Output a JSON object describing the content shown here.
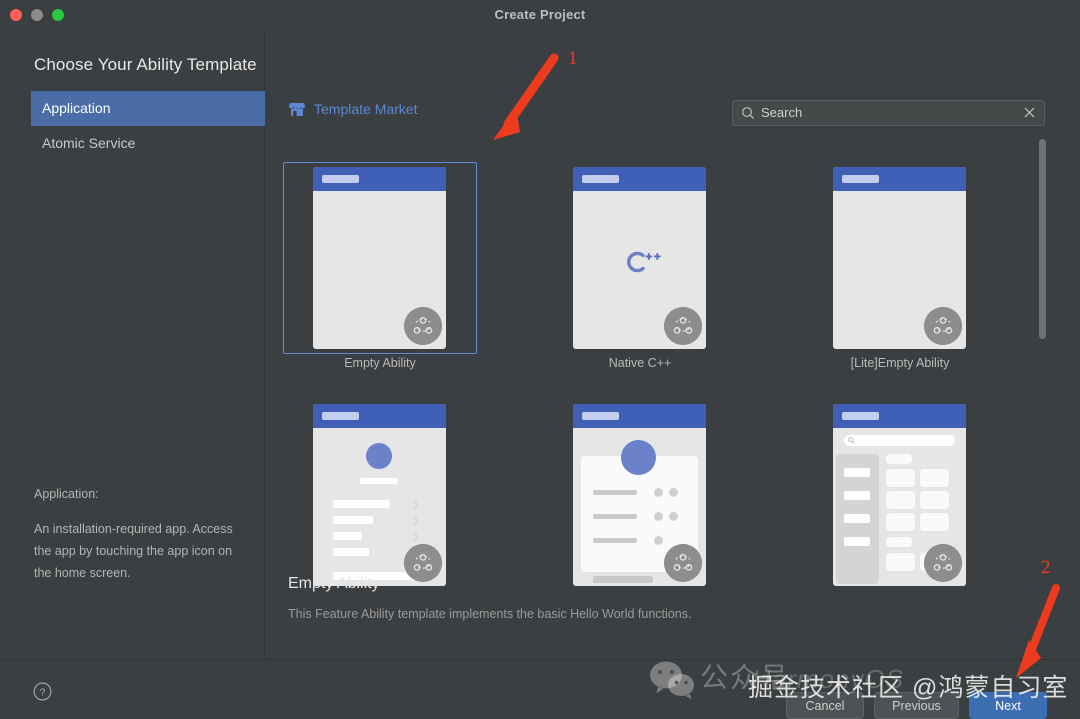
{
  "window": {
    "title": "Create Project",
    "traffic_lights": [
      "close",
      "minimize",
      "maximize"
    ]
  },
  "left_pane": {
    "heading": "Choose Your Ability Template",
    "categories": [
      {
        "label": "Application",
        "selected": true
      },
      {
        "label": "Atomic Service",
        "selected": false
      }
    ],
    "description_title": "Application:",
    "description_body": "An installation-required app. Access the app by touching the app icon on the home screen."
  },
  "right_pane": {
    "market_label": "Template Market",
    "market_icon": "storefront-icon",
    "search": {
      "placeholder": "Search",
      "value": "",
      "icon": "search-icon",
      "clear_icon": "close-icon"
    },
    "templates": [
      {
        "caption": "Empty Ability",
        "kind": "empty",
        "selected": true
      },
      {
        "caption": "Native C++",
        "kind": "cpp",
        "selected": false
      },
      {
        "caption": "[Lite]Empty Ability",
        "kind": "empty",
        "selected": false
      },
      {
        "caption": "",
        "kind": "profile",
        "selected": false
      },
      {
        "caption": "",
        "kind": "contact",
        "selected": false
      },
      {
        "caption": "",
        "kind": "catalog",
        "selected": false
      }
    ],
    "detail": {
      "title": "Empty Ability",
      "description": "This Feature Ability template implements the basic Hello World functions."
    }
  },
  "bottom_bar": {
    "help_icon": "help-circle-icon",
    "buttons": [
      {
        "label": "Cancel",
        "style": "secondary"
      },
      {
        "label": "Previous",
        "style": "secondary"
      },
      {
        "label": "Next",
        "style": "primary"
      }
    ]
  },
  "annotations": [
    {
      "number": "1",
      "target": "empty-ability-template-card"
    },
    {
      "number": "2",
      "target": "next-button"
    }
  ],
  "watermarks": {
    "wechat_icon": "wechat-icon",
    "gongzhonghao": "公众号",
    "harmony": "HarmonyOS",
    "juejin": "掘金技术社区 @鸿蒙自习室"
  },
  "colors": {
    "window_bg": "#3c3f41",
    "selection_blue": "#4a6da7",
    "accent_blue": "#5b87d4",
    "primary_button": "#3c6eb4",
    "thumb_bar": "#4060b8",
    "annotation_red": "#ee3b1e"
  }
}
